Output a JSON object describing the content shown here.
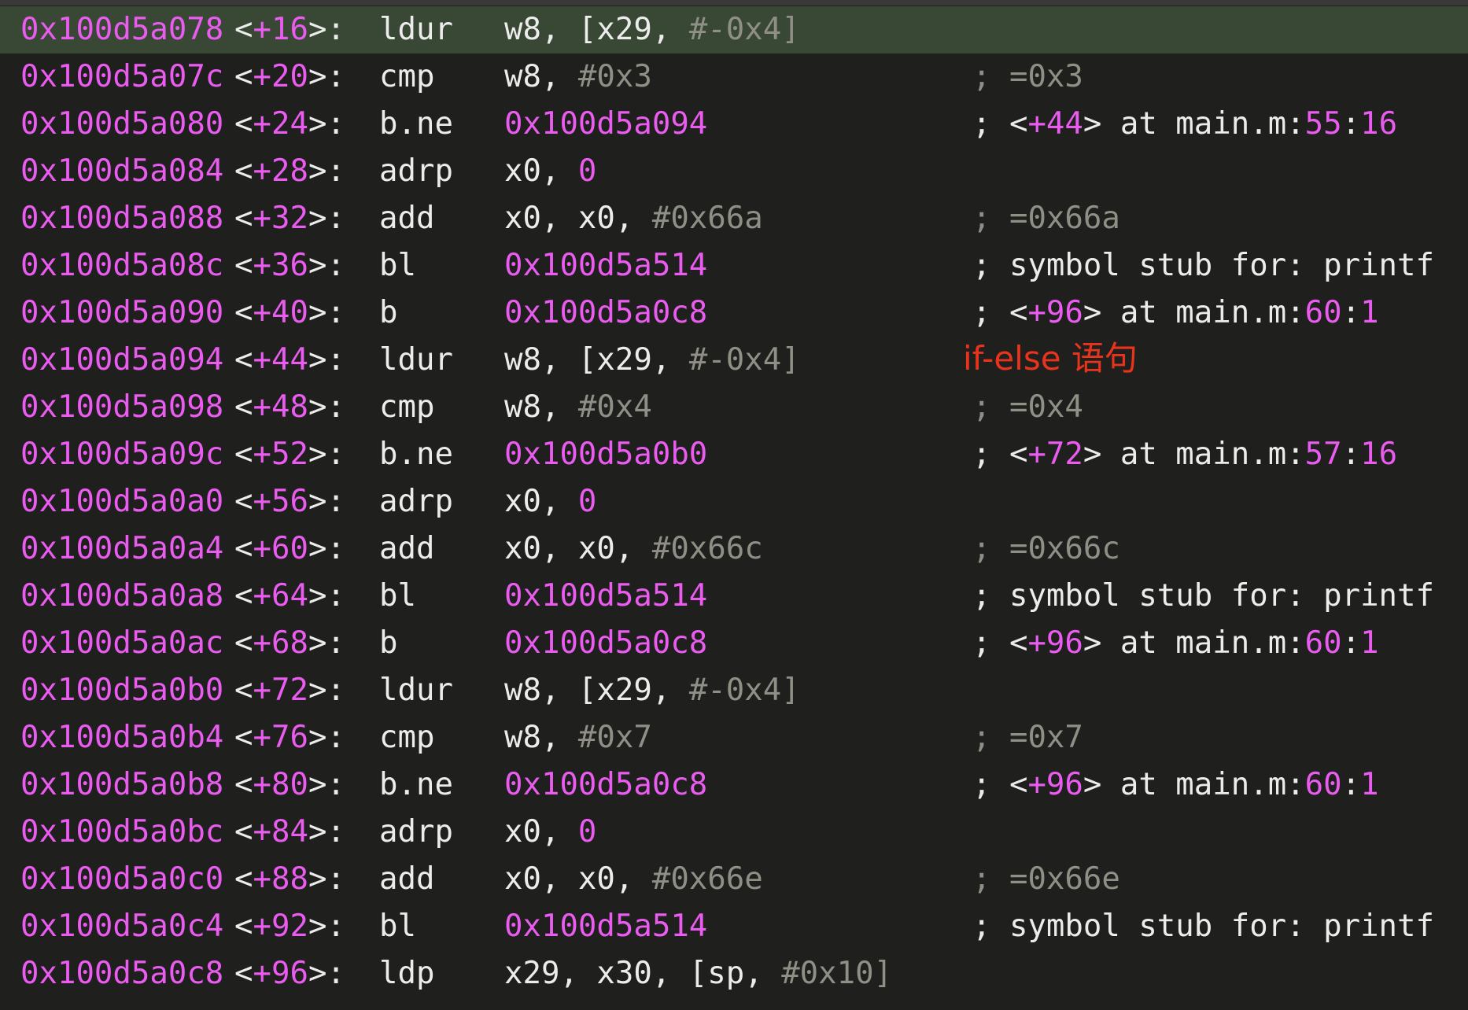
{
  "annotation": "if-else 语句",
  "current_index": 0,
  "rows": [
    {
      "addr": "0x100d5a078",
      "off": "+16",
      "mnem": "ldur",
      "ops": [
        [
          "w8, [x29, ",
          "white"
        ],
        [
          "#-0x4",
          "grey"
        ],
        [
          "]",
          "grey"
        ]
      ],
      "cmt": []
    },
    {
      "addr": "0x100d5a07c",
      "off": "+20",
      "mnem": "cmp",
      "ops": [
        [
          "w8, ",
          "white"
        ],
        [
          "#0x3",
          "grey"
        ]
      ],
      "cmt": [
        [
          "; =0x3",
          "grey"
        ]
      ]
    },
    {
      "addr": "0x100d5a080",
      "off": "+24",
      "mnem": "b.ne",
      "ops": [
        [
          "0x100d5a094",
          "pink"
        ]
      ],
      "cmt": [
        [
          "; <",
          "white"
        ],
        [
          "+44",
          "pink"
        ],
        [
          "> at main.m:",
          "white"
        ],
        [
          "55",
          "pink"
        ],
        [
          ":",
          "white"
        ],
        [
          "16",
          "pink"
        ]
      ]
    },
    {
      "addr": "0x100d5a084",
      "off": "+28",
      "mnem": "adrp",
      "ops": [
        [
          "x0, ",
          "white"
        ],
        [
          "0",
          "pink"
        ]
      ],
      "cmt": []
    },
    {
      "addr": "0x100d5a088",
      "off": "+32",
      "mnem": "add",
      "ops": [
        [
          "x0, x0, ",
          "white"
        ],
        [
          "#0x66a",
          "grey"
        ]
      ],
      "cmt": [
        [
          "; =0x66a",
          "grey"
        ]
      ]
    },
    {
      "addr": "0x100d5a08c",
      "off": "+36",
      "mnem": "bl",
      "ops": [
        [
          "0x100d5a514",
          "pink"
        ]
      ],
      "cmt": [
        [
          "; symbol stub for: printf",
          "white"
        ]
      ]
    },
    {
      "addr": "0x100d5a090",
      "off": "+40",
      "mnem": "b",
      "ops": [
        [
          "0x100d5a0c8",
          "pink"
        ]
      ],
      "cmt": [
        [
          "; <",
          "white"
        ],
        [
          "+96",
          "pink"
        ],
        [
          "> at main.m:",
          "white"
        ],
        [
          "60",
          "pink"
        ],
        [
          ":",
          "white"
        ],
        [
          "1",
          "pink"
        ]
      ]
    },
    {
      "addr": "0x100d5a094",
      "off": "+44",
      "mnem": "ldur",
      "ops": [
        [
          "w8, [x29, ",
          "white"
        ],
        [
          "#-0x4",
          "grey"
        ],
        [
          "]",
          "grey"
        ]
      ],
      "cmt": []
    },
    {
      "addr": "0x100d5a098",
      "off": "+48",
      "mnem": "cmp",
      "ops": [
        [
          "w8, ",
          "white"
        ],
        [
          "#0x4",
          "grey"
        ]
      ],
      "cmt": [
        [
          "; =0x4",
          "grey"
        ]
      ]
    },
    {
      "addr": "0x100d5a09c",
      "off": "+52",
      "mnem": "b.ne",
      "ops": [
        [
          "0x100d5a0b0",
          "pink"
        ]
      ],
      "cmt": [
        [
          "; <",
          "white"
        ],
        [
          "+72",
          "pink"
        ],
        [
          "> at main.m:",
          "white"
        ],
        [
          "57",
          "pink"
        ],
        [
          ":",
          "white"
        ],
        [
          "16",
          "pink"
        ]
      ]
    },
    {
      "addr": "0x100d5a0a0",
      "off": "+56",
      "mnem": "adrp",
      "ops": [
        [
          "x0, ",
          "white"
        ],
        [
          "0",
          "pink"
        ]
      ],
      "cmt": []
    },
    {
      "addr": "0x100d5a0a4",
      "off": "+60",
      "mnem": "add",
      "ops": [
        [
          "x0, x0, ",
          "white"
        ],
        [
          "#0x66c",
          "grey"
        ]
      ],
      "cmt": [
        [
          "; =0x66c",
          "grey"
        ]
      ]
    },
    {
      "addr": "0x100d5a0a8",
      "off": "+64",
      "mnem": "bl",
      "ops": [
        [
          "0x100d5a514",
          "pink"
        ]
      ],
      "cmt": [
        [
          "; symbol stub for: printf",
          "white"
        ]
      ]
    },
    {
      "addr": "0x100d5a0ac",
      "off": "+68",
      "mnem": "b",
      "ops": [
        [
          "0x100d5a0c8",
          "pink"
        ]
      ],
      "cmt": [
        [
          "; <",
          "white"
        ],
        [
          "+96",
          "pink"
        ],
        [
          "> at main.m:",
          "white"
        ],
        [
          "60",
          "pink"
        ],
        [
          ":",
          "white"
        ],
        [
          "1",
          "pink"
        ]
      ]
    },
    {
      "addr": "0x100d5a0b0",
      "off": "+72",
      "mnem": "ldur",
      "ops": [
        [
          "w8, [x29, ",
          "white"
        ],
        [
          "#-0x4",
          "grey"
        ],
        [
          "]",
          "grey"
        ]
      ],
      "cmt": []
    },
    {
      "addr": "0x100d5a0b4",
      "off": "+76",
      "mnem": "cmp",
      "ops": [
        [
          "w8, ",
          "white"
        ],
        [
          "#0x7",
          "grey"
        ]
      ],
      "cmt": [
        [
          "; =0x7",
          "grey"
        ]
      ]
    },
    {
      "addr": "0x100d5a0b8",
      "off": "+80",
      "mnem": "b.ne",
      "ops": [
        [
          "0x100d5a0c8",
          "pink"
        ]
      ],
      "cmt": [
        [
          "; <",
          "white"
        ],
        [
          "+96",
          "pink"
        ],
        [
          "> at main.m:",
          "white"
        ],
        [
          "60",
          "pink"
        ],
        [
          ":",
          "white"
        ],
        [
          "1",
          "pink"
        ]
      ]
    },
    {
      "addr": "0x100d5a0bc",
      "off": "+84",
      "mnem": "adrp",
      "ops": [
        [
          "x0, ",
          "white"
        ],
        [
          "0",
          "pink"
        ]
      ],
      "cmt": []
    },
    {
      "addr": "0x100d5a0c0",
      "off": "+88",
      "mnem": "add",
      "ops": [
        [
          "x0, x0, ",
          "white"
        ],
        [
          "#0x66e",
          "grey"
        ]
      ],
      "cmt": [
        [
          "; =0x66e",
          "grey"
        ]
      ]
    },
    {
      "addr": "0x100d5a0c4",
      "off": "+92",
      "mnem": "bl",
      "ops": [
        [
          "0x100d5a514",
          "pink"
        ]
      ],
      "cmt": [
        [
          "; symbol stub for: printf",
          "white"
        ]
      ]
    },
    {
      "addr": "0x100d5a0c8",
      "off": "+96",
      "mnem": "ldp",
      "ops": [
        [
          "x29, x30, [sp, ",
          "white"
        ],
        [
          "#0x10",
          "grey"
        ],
        [
          "]",
          "grey"
        ]
      ],
      "cmt": []
    }
  ]
}
